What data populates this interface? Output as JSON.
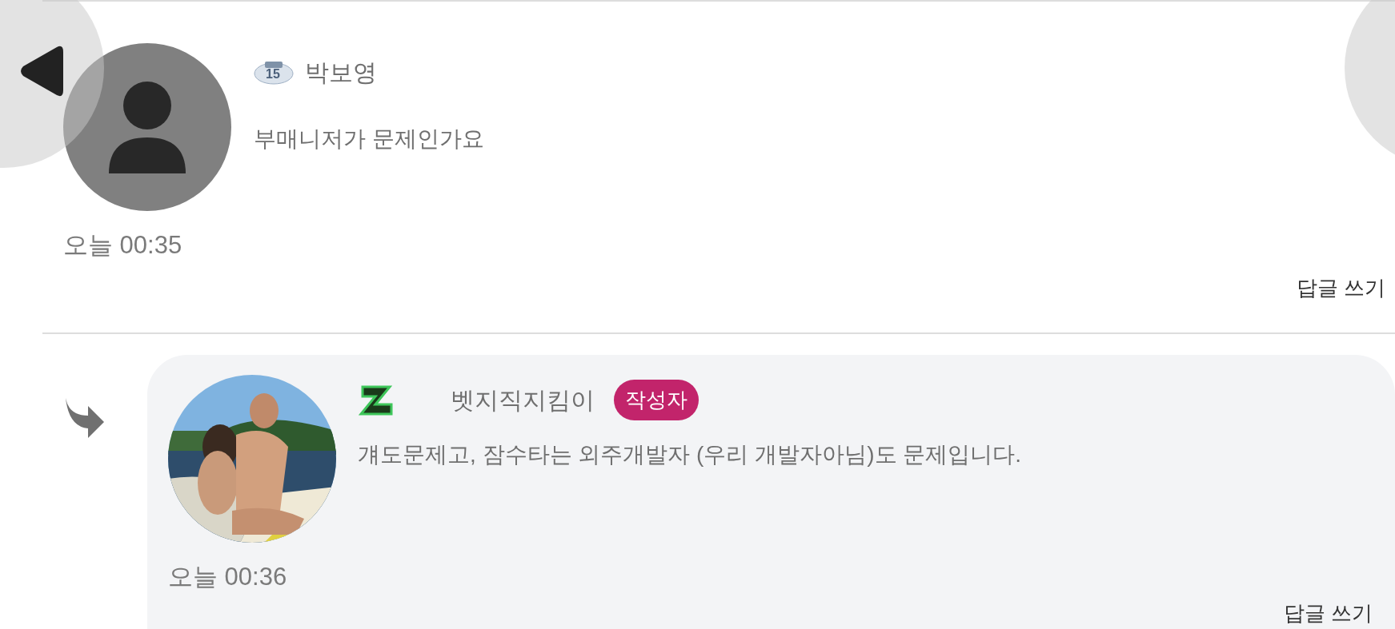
{
  "comments": [
    {
      "kind": "comment",
      "level_badge": "15",
      "author": "박보영",
      "text": "부매니저가 문제인가요",
      "time": "오늘 00:35",
      "reply_link": "답글 쓰기"
    },
    {
      "kind": "reply",
      "author": "벳지직지킴이",
      "author_badge": "작성자",
      "text": "걔도문제고, 잠수타는 외주개발자 (우리 개발자아님)도 문제입니다.",
      "time": "오늘 00:36",
      "reply_link": "답글 쓰기"
    }
  ]
}
